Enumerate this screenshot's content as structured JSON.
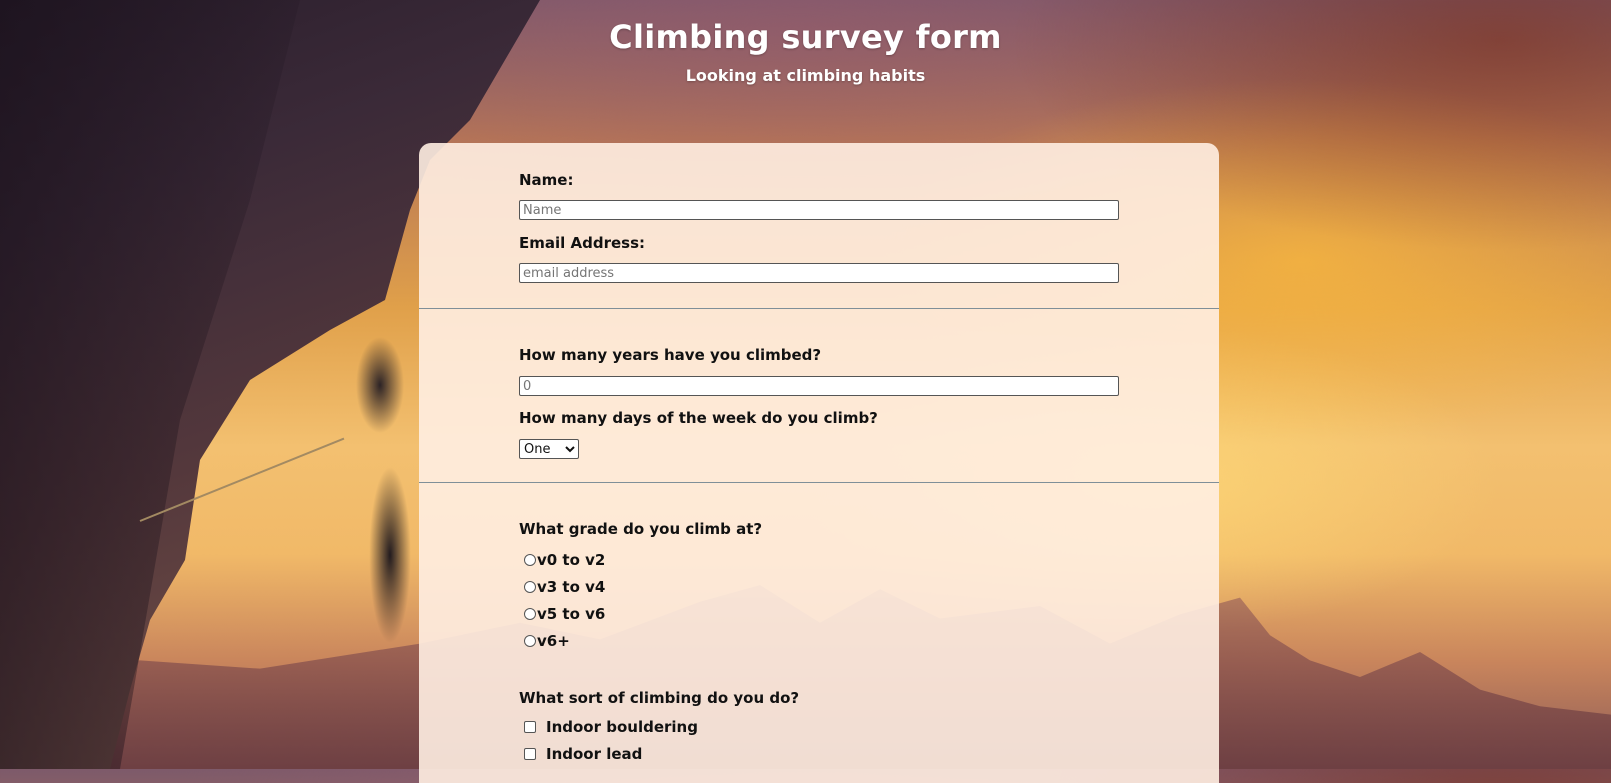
{
  "header": {
    "title": "Climbing survey form",
    "subtitle": "Looking at climbing habits"
  },
  "personal": {
    "name_label": "Name:",
    "name_placeholder": "Name",
    "email_label": "Email Address:",
    "email_placeholder": "email address"
  },
  "habits": {
    "years_label": "How many years have you climbed?",
    "years_placeholder": "0",
    "days_label": "How many days of the week do you climb?",
    "days_selected": "One"
  },
  "grade": {
    "question": "What grade do you climb at?",
    "options": [
      "v0 to v2",
      "v3 to v4",
      "v5 to v6",
      "v6+"
    ]
  },
  "style": {
    "question": "What sort of climbing do you do?",
    "options": [
      "Indoor bouldering",
      "Indoor lead"
    ]
  },
  "colors": {
    "card_background": "#ffeee2",
    "divider": "#7f8f98",
    "heading_text": "#ffffff"
  }
}
